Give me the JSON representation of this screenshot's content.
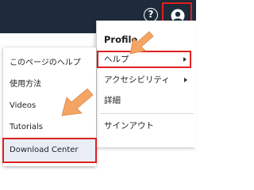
{
  "header": {
    "help_glyph": "?",
    "help_icon": "question-circle-icon",
    "user_icon": "user-circle-icon"
  },
  "profile_menu": {
    "title": "Profile",
    "items": [
      {
        "label": "ヘルプ",
        "has_submenu": true,
        "selected": true
      },
      {
        "label": "アクセシビリティ",
        "has_submenu": true,
        "selected": false
      },
      {
        "label": "詳細",
        "has_submenu": false,
        "selected": false
      },
      {
        "label": "サインアウト",
        "has_submenu": false,
        "selected": false
      }
    ]
  },
  "help_menu": {
    "items": [
      {
        "label": "このページのヘルプ",
        "selected": false
      },
      {
        "label": "使用方法",
        "selected": false
      },
      {
        "label": "Videos",
        "selected": false
      },
      {
        "label": "Tutorials",
        "selected": false
      },
      {
        "label": "Download Center",
        "selected": true
      }
    ]
  },
  "colors": {
    "topbar": "#1e2b3a",
    "highlight_border": "#e02020",
    "pointer_arrow": "#f4a463",
    "selected_bg": "#e9eef6"
  }
}
